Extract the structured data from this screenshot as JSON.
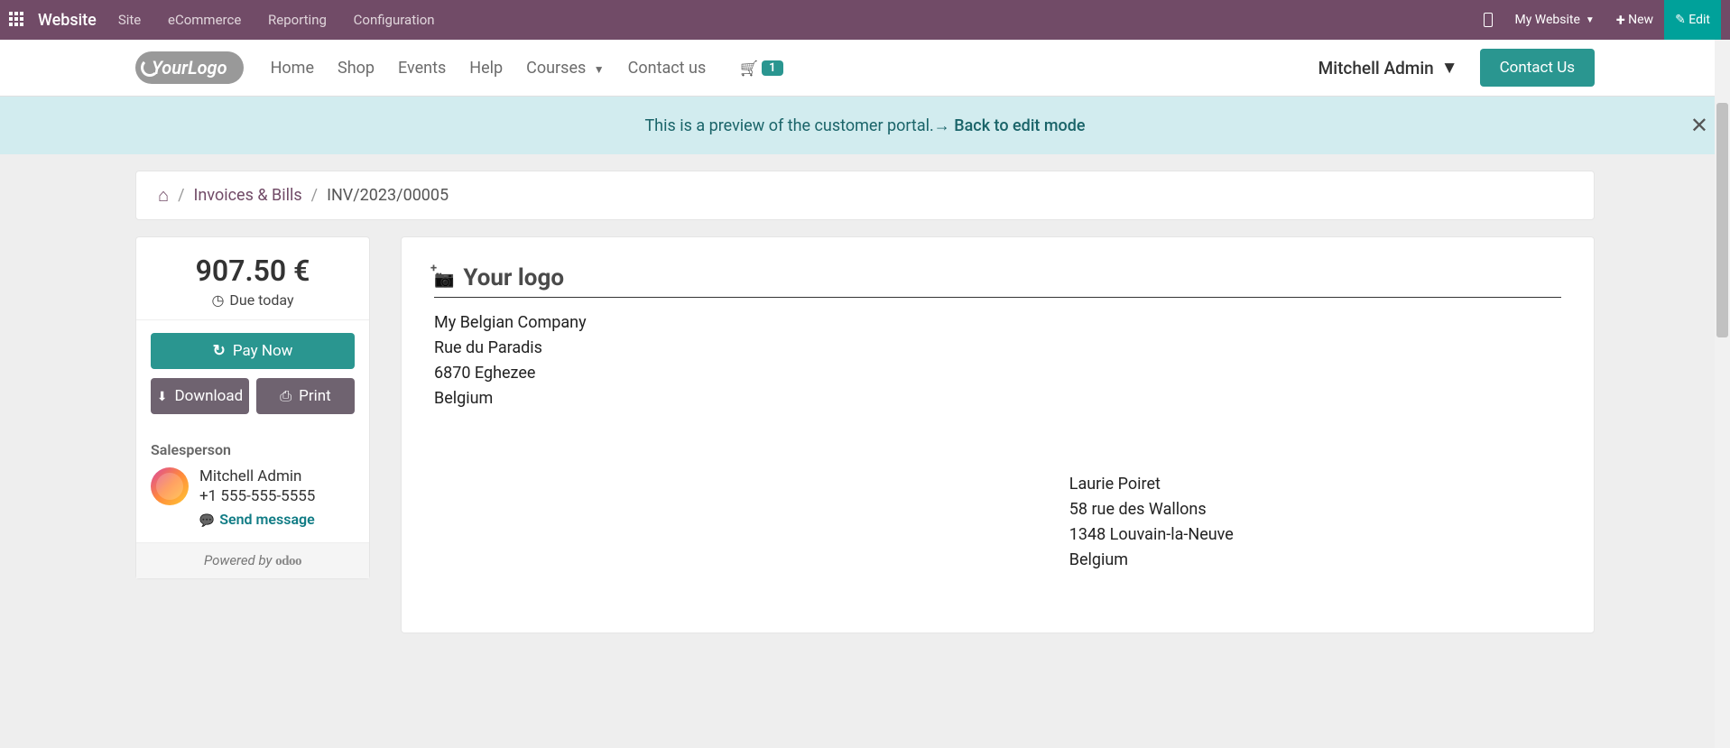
{
  "topbar": {
    "brand": "Website",
    "menu": [
      "Site",
      "eCommerce",
      "Reporting",
      "Configuration"
    ],
    "my_website": "My Website",
    "new": "New",
    "edit": "Edit"
  },
  "site_nav": {
    "logo_text": "YourLogo",
    "links": {
      "home": "Home",
      "shop": "Shop",
      "events": "Events",
      "help": "Help",
      "courses": "Courses",
      "contact_us": "Contact us"
    },
    "cart_count": "1",
    "user": "Mitchell Admin",
    "contact_btn": "Contact Us"
  },
  "alert": {
    "text": "This is a preview of the customer portal. ",
    "link": "Back to edit mode"
  },
  "breadcrumb": {
    "invoices": "Invoices & Bills",
    "current": "INV/2023/00005"
  },
  "side": {
    "amount": "907.50 €",
    "due": "Due today",
    "pay": "Pay Now",
    "download": "Download",
    "print": "Print",
    "salesperson_label": "Salesperson",
    "salesperson_name": "Mitchell Admin",
    "salesperson_phone": "+1 555-555-5555",
    "send_message": "Send message",
    "powered_by": "Powered by ",
    "powered_brand": "odoo"
  },
  "doc": {
    "logo_title": "Your logo",
    "from": {
      "l1": "My Belgian Company",
      "l2": "Rue du Paradis",
      "l3": "6870 Eghezee",
      "l4": "Belgium"
    },
    "to": {
      "l1": "Laurie Poiret",
      "l2": "58 rue des Wallons",
      "l3": "1348 Louvain-la-Neuve",
      "l4": "Belgium"
    }
  }
}
